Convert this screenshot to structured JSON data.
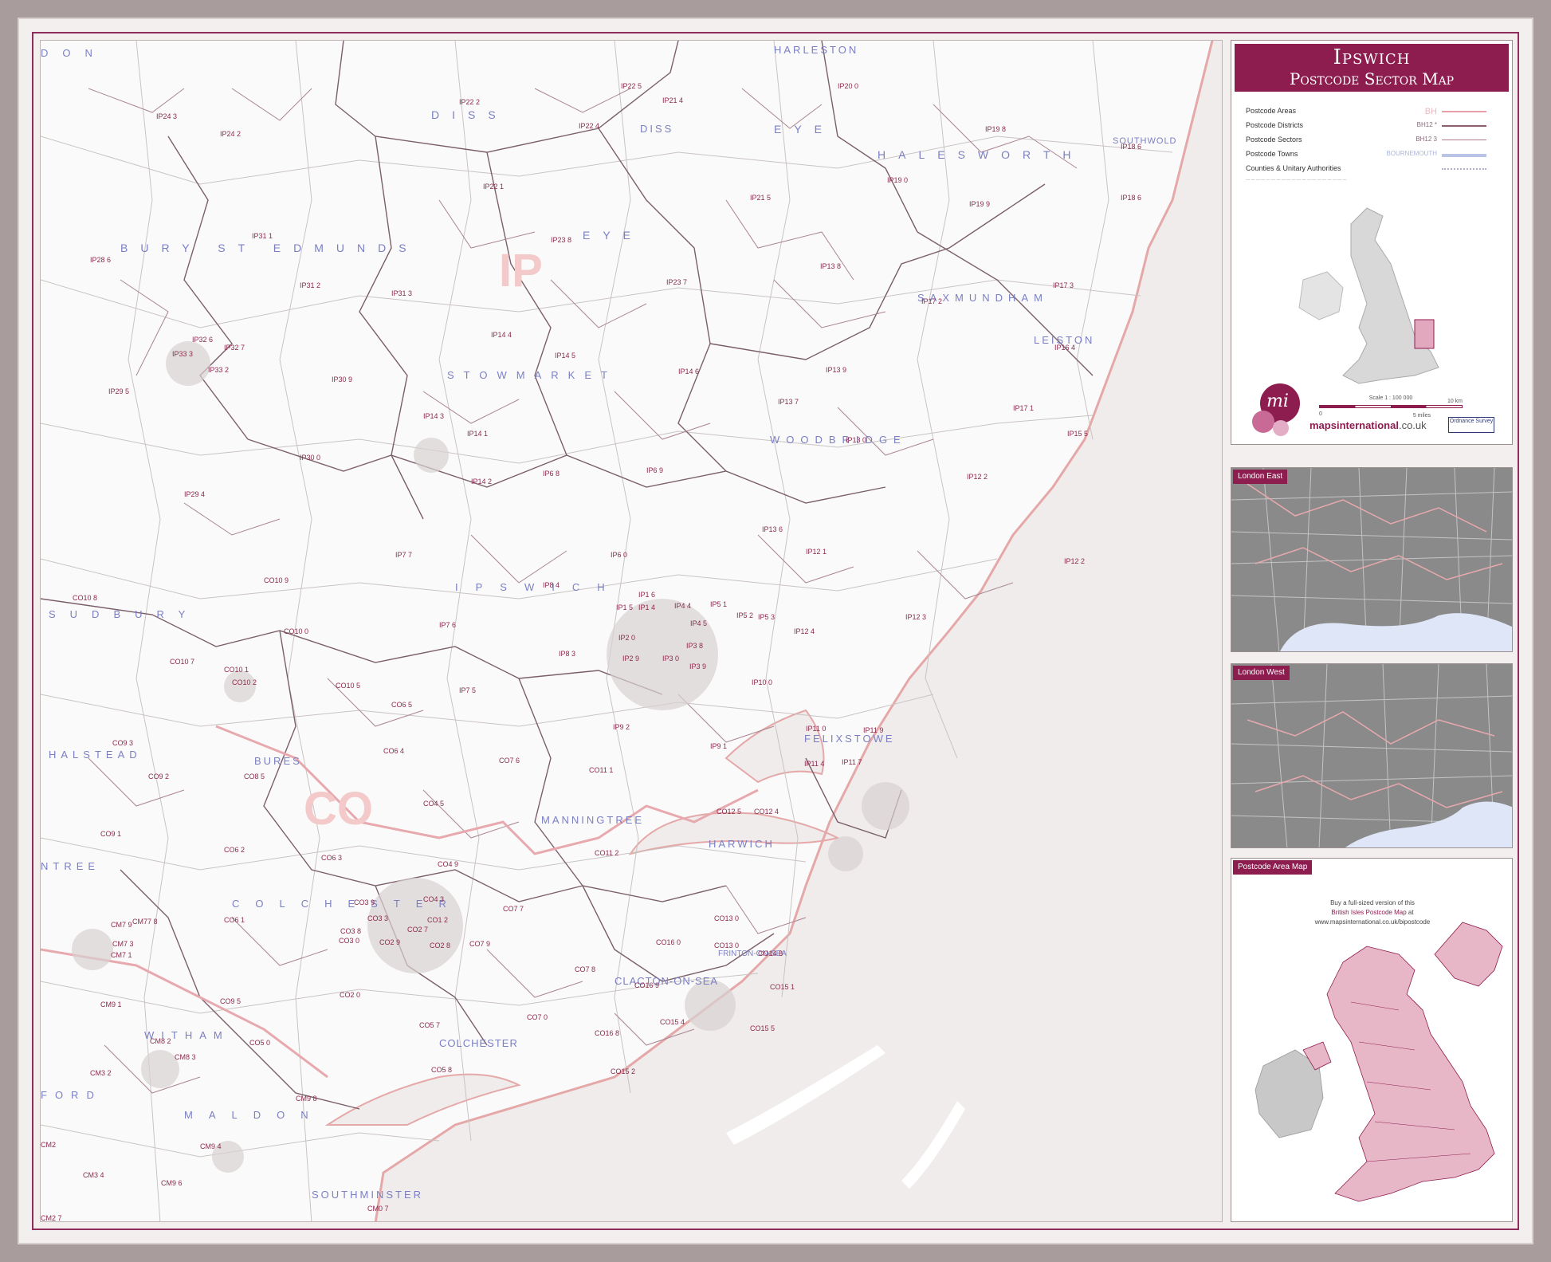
{
  "title": {
    "main": "Ipswich",
    "sub": "Postcode Sector Map"
  },
  "legend": [
    {
      "label": "Postcode Areas",
      "sample": "BH",
      "color": "#e8a0a8"
    },
    {
      "label": "Postcode Districts",
      "sample": "BH12 *",
      "color": "#8a6070"
    },
    {
      "label": "Postcode Sectors",
      "sample": "BH12 3",
      "color": "#b07a88"
    },
    {
      "label": "Postcode Towns",
      "sample": "BOURNEMOUTH",
      "color": "#b9c3e6"
    },
    {
      "label": "Counties & Unitary Authorities",
      "sample": "",
      "color": "#b0b0d0"
    }
  ],
  "scale": {
    "label": "Scale 1 : 100 000",
    "left": "0",
    "right": "10 km",
    "miles": "5 miles"
  },
  "brand": {
    "name": "mapsinternational",
    "suffix": ".co.uk",
    "logo": "mi",
    "badge": "Ordnance Survey"
  },
  "insets": {
    "london_east": "London East",
    "london_west": "London West",
    "postcode_area_map": "Postcode Area Map"
  },
  "pam_text": {
    "line1": "Buy a full-sized version of this",
    "line2": "British Isles Postcode Map",
    "line2b": " at",
    "line3": "www.mapsinternational.co.uk/bipostcode"
  },
  "towns": {
    "harleston": "HARLESTON",
    "diss": "DISS",
    "eye_town": "EYE",
    "halesworth": "HALESWORTH",
    "southwold": "SOUTHWOLD",
    "bury": "BURY ST EDMUNDS",
    "saxmundham": "SAXMUNDHAM",
    "leiston": "LEISTON",
    "stowmarket": "STOWMARKET",
    "woodbridge": "WOODBRIDGE",
    "ipswich": "IPSWICH",
    "sudbury": "SUDBURY",
    "halstead": "HALSTEAD",
    "bures": "BURES",
    "felixstowe": "FELIXSTOWE",
    "manningtree": "MANNINGTREE",
    "harwich": "HARWICH",
    "colchester": "COLCHESTER",
    "colchester2": "COLCHESTER",
    "clacton": "CLACTON-ON-SEA",
    "frinton": "FRINTON-ON-SEA",
    "witham": "WITHAM",
    "maldon": "MALDON",
    "southminster": "SOUTHMINSTER",
    "braintree": "NTREE",
    "chelmsford": "FORD",
    "london_frag": "DON"
  },
  "areas": {
    "ip": "IP",
    "co": "CO"
  },
  "sectors": [
    "IP22 5",
    "IP20 0",
    "IP21 4",
    "IP24 3",
    "IP22 2",
    "IP22 4",
    "IP24 2",
    "IP19 8",
    "IP18 6",
    "IP19 0",
    "IP22 1",
    "IP21 5",
    "IP18 6",
    "IP19 9",
    "IP31 1",
    "IP23 8",
    "IP28 6",
    "IP13 8",
    "IP31 2",
    "IP31 3",
    "IP23 7",
    "IP17 3",
    "IP17 2",
    "IP14 4",
    "IP32 6",
    "IP32 7",
    "IP16 4",
    "IP33 3",
    "IP33 2",
    "IP14 5",
    "IP14 6",
    "IP13 9",
    "IP29 5",
    "IP30 9",
    "IP13 7",
    "IP17 1",
    "IP14 3",
    "IP14 1",
    "IP15 5",
    "IP13 0",
    "IP30 0",
    "IP6 8",
    "IP6 9",
    "IP12 2",
    "IP14 2",
    "IP29 4",
    "IP13 6",
    "IP7 7",
    "IP6 0",
    "IP12 1",
    "IP12 2",
    "CO10 8",
    "CO10 9",
    "IP8 4",
    "IP1 6",
    "IP12 3",
    "IP1 5",
    "IP1 4",
    "IP4 4",
    "IP5 1",
    "IP5 2",
    "IP5 3",
    "IP7 6",
    "IP4 5",
    "IP12 4",
    "CO10 0",
    "IP2 0",
    "IP3 8",
    "CO10 7",
    "CO10 1",
    "IP8 3",
    "IP2 9",
    "IP3 0",
    "IP3 9",
    "CO10 2",
    "CO10 5",
    "IP10 0",
    "IP7 5",
    "CO6 5",
    "IP9 2",
    "IP11 0",
    "IP11 9",
    "CO9 3",
    "CO6 4",
    "IP9 1",
    "CO7 6",
    "IP11 4",
    "IP11 7",
    "CO9 2",
    "CO8 5",
    "CO11 1",
    "CO4 5",
    "CO12 4",
    "CO9 1",
    "CO6 2",
    "CO12 5",
    "CO6 3",
    "CO11 2",
    "CO4 9",
    "CO3 9",
    "CO4 3",
    "CO7 7",
    "CM7 9",
    "CM77 8",
    "CO6 1",
    "CO3 3",
    "CO1 2",
    "CO13 0",
    "CO3 8",
    "CO2 7",
    "CM7 3",
    "CO3 0",
    "CO2 9",
    "CO2 8",
    "CO7 9",
    "CO16 0",
    "CM7 1",
    "CO13 0",
    "CO14 8",
    "CO7 8",
    "CO2 0",
    "CO9 5",
    "CO16 9",
    "CO15 1",
    "CM9 1",
    "CO5 7",
    "CO7 0",
    "CO15 4",
    "CO16 8",
    "CO15 5",
    "CM8 2",
    "CM8 3",
    "CO5 0",
    "CM3 2",
    "CO5 8",
    "CO15 2",
    "CM9 8",
    "CM2",
    "CM9 4",
    "CM3 4",
    "CM9 6",
    "CM0 7",
    "CM2 7"
  ]
}
